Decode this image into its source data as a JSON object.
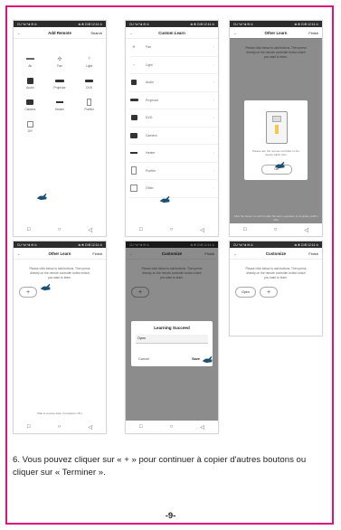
{
  "status_bar": {
    "left": "CU *ul *ul ✉ ⊙",
    "right": "⊗ ✻ ⊡ ⊞ 12:14 ⊙"
  },
  "nav_icons": [
    "□",
    "○",
    "◁"
  ],
  "colors": {
    "frame": "#e0117a",
    "overlay": "rgba(0,0,0,0.45)",
    "pointer": "#1d4f73"
  },
  "screen1": {
    "back": "←",
    "title": "Add Remote",
    "right": "Search",
    "items": [
      {
        "label": "Air",
        "icon": "air-conditioner-icon"
      },
      {
        "label": "Fan",
        "icon": "fan-icon"
      },
      {
        "label": "Light",
        "icon": "light-icon"
      },
      {
        "label": "Audio",
        "icon": "audio-icon"
      },
      {
        "label": "Projector",
        "icon": "projector-icon"
      },
      {
        "label": "DVD",
        "icon": "dvd-icon"
      },
      {
        "label": "Camera",
        "icon": "camera-icon"
      },
      {
        "label": "Heater",
        "icon": "heater-icon"
      },
      {
        "label": "Purifier",
        "icon": "purifier-icon"
      },
      {
        "label": "DIY",
        "icon": "diy-icon"
      }
    ]
  },
  "screen2": {
    "back": "←",
    "title": "Custom Learn",
    "items": [
      "Fan",
      "Light",
      "Audio",
      "Projector",
      "DVD",
      "Camera",
      "Heater",
      "Purifier",
      "Other"
    ]
  },
  "screen3": {
    "back": "←",
    "title": "Other Learn",
    "right": "Finish",
    "instruction": "Please click below to add buttons. Then press directly on the remote controller button which you want to learn.",
    "modal_text": "Please aim the remote controller to the device within 3cm",
    "ok": "OK",
    "footer": "Click the button to confirm after the learn operation is complete (within 10s)"
  },
  "screen4": {
    "back": "←",
    "title": "Other Learn",
    "right": "Finish",
    "instruction": "Please click below to add buttons. Then press directly on the remote controller button which you want to learn.",
    "plus": "+",
    "footer": "Wait to receive data. Countdown 18 s"
  },
  "screen5": {
    "back": "←",
    "title": "Customize",
    "right": "Finish",
    "instruction": "Please click below to add buttons. Then press directly on the remote controller button which you want to learn.",
    "plus": "+",
    "dialog_title": "Learning Succeed",
    "input_value": "Open",
    "cancel": "Cancel",
    "save": "Save"
  },
  "screen6": {
    "back": "←",
    "title": "Customize",
    "right": "Finish",
    "instruction": "Please click below to add buttons. Then press directly on the remote controller button which you want to learn.",
    "open": "Open",
    "plus": "+"
  },
  "caption": "6. Vous pouvez cliquer sur « + » pour continuer à copier d'autres boutons ou cliquer sur « Terminer ».",
  "page_number": "-9-"
}
